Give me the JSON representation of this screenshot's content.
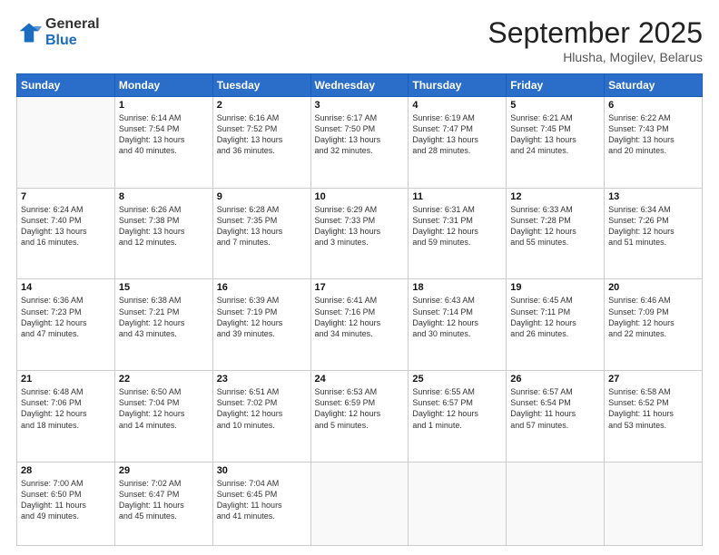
{
  "logo": {
    "general": "General",
    "blue": "Blue"
  },
  "header": {
    "month": "September 2025",
    "location": "Hlusha, Mogilev, Belarus"
  },
  "weekdays": [
    "Sunday",
    "Monday",
    "Tuesday",
    "Wednesday",
    "Thursday",
    "Friday",
    "Saturday"
  ],
  "weeks": [
    [
      {
        "day": "",
        "info": ""
      },
      {
        "day": "1",
        "info": "Sunrise: 6:14 AM\nSunset: 7:54 PM\nDaylight: 13 hours\nand 40 minutes."
      },
      {
        "day": "2",
        "info": "Sunrise: 6:16 AM\nSunset: 7:52 PM\nDaylight: 13 hours\nand 36 minutes."
      },
      {
        "day": "3",
        "info": "Sunrise: 6:17 AM\nSunset: 7:50 PM\nDaylight: 13 hours\nand 32 minutes."
      },
      {
        "day": "4",
        "info": "Sunrise: 6:19 AM\nSunset: 7:47 PM\nDaylight: 13 hours\nand 28 minutes."
      },
      {
        "day": "5",
        "info": "Sunrise: 6:21 AM\nSunset: 7:45 PM\nDaylight: 13 hours\nand 24 minutes."
      },
      {
        "day": "6",
        "info": "Sunrise: 6:22 AM\nSunset: 7:43 PM\nDaylight: 13 hours\nand 20 minutes."
      }
    ],
    [
      {
        "day": "7",
        "info": "Sunrise: 6:24 AM\nSunset: 7:40 PM\nDaylight: 13 hours\nand 16 minutes."
      },
      {
        "day": "8",
        "info": "Sunrise: 6:26 AM\nSunset: 7:38 PM\nDaylight: 13 hours\nand 12 minutes."
      },
      {
        "day": "9",
        "info": "Sunrise: 6:28 AM\nSunset: 7:35 PM\nDaylight: 13 hours\nand 7 minutes."
      },
      {
        "day": "10",
        "info": "Sunrise: 6:29 AM\nSunset: 7:33 PM\nDaylight: 13 hours\nand 3 minutes."
      },
      {
        "day": "11",
        "info": "Sunrise: 6:31 AM\nSunset: 7:31 PM\nDaylight: 12 hours\nand 59 minutes."
      },
      {
        "day": "12",
        "info": "Sunrise: 6:33 AM\nSunset: 7:28 PM\nDaylight: 12 hours\nand 55 minutes."
      },
      {
        "day": "13",
        "info": "Sunrise: 6:34 AM\nSunset: 7:26 PM\nDaylight: 12 hours\nand 51 minutes."
      }
    ],
    [
      {
        "day": "14",
        "info": "Sunrise: 6:36 AM\nSunset: 7:23 PM\nDaylight: 12 hours\nand 47 minutes."
      },
      {
        "day": "15",
        "info": "Sunrise: 6:38 AM\nSunset: 7:21 PM\nDaylight: 12 hours\nand 43 minutes."
      },
      {
        "day": "16",
        "info": "Sunrise: 6:39 AM\nSunset: 7:19 PM\nDaylight: 12 hours\nand 39 minutes."
      },
      {
        "day": "17",
        "info": "Sunrise: 6:41 AM\nSunset: 7:16 PM\nDaylight: 12 hours\nand 34 minutes."
      },
      {
        "day": "18",
        "info": "Sunrise: 6:43 AM\nSunset: 7:14 PM\nDaylight: 12 hours\nand 30 minutes."
      },
      {
        "day": "19",
        "info": "Sunrise: 6:45 AM\nSunset: 7:11 PM\nDaylight: 12 hours\nand 26 minutes."
      },
      {
        "day": "20",
        "info": "Sunrise: 6:46 AM\nSunset: 7:09 PM\nDaylight: 12 hours\nand 22 minutes."
      }
    ],
    [
      {
        "day": "21",
        "info": "Sunrise: 6:48 AM\nSunset: 7:06 PM\nDaylight: 12 hours\nand 18 minutes."
      },
      {
        "day": "22",
        "info": "Sunrise: 6:50 AM\nSunset: 7:04 PM\nDaylight: 12 hours\nand 14 minutes."
      },
      {
        "day": "23",
        "info": "Sunrise: 6:51 AM\nSunset: 7:02 PM\nDaylight: 12 hours\nand 10 minutes."
      },
      {
        "day": "24",
        "info": "Sunrise: 6:53 AM\nSunset: 6:59 PM\nDaylight: 12 hours\nand 5 minutes."
      },
      {
        "day": "25",
        "info": "Sunrise: 6:55 AM\nSunset: 6:57 PM\nDaylight: 12 hours\nand 1 minute."
      },
      {
        "day": "26",
        "info": "Sunrise: 6:57 AM\nSunset: 6:54 PM\nDaylight: 11 hours\nand 57 minutes."
      },
      {
        "day": "27",
        "info": "Sunrise: 6:58 AM\nSunset: 6:52 PM\nDaylight: 11 hours\nand 53 minutes."
      }
    ],
    [
      {
        "day": "28",
        "info": "Sunrise: 7:00 AM\nSunset: 6:50 PM\nDaylight: 11 hours\nand 49 minutes."
      },
      {
        "day": "29",
        "info": "Sunrise: 7:02 AM\nSunset: 6:47 PM\nDaylight: 11 hours\nand 45 minutes."
      },
      {
        "day": "30",
        "info": "Sunrise: 7:04 AM\nSunset: 6:45 PM\nDaylight: 11 hours\nand 41 minutes."
      },
      {
        "day": "",
        "info": ""
      },
      {
        "day": "",
        "info": ""
      },
      {
        "day": "",
        "info": ""
      },
      {
        "day": "",
        "info": ""
      }
    ]
  ]
}
